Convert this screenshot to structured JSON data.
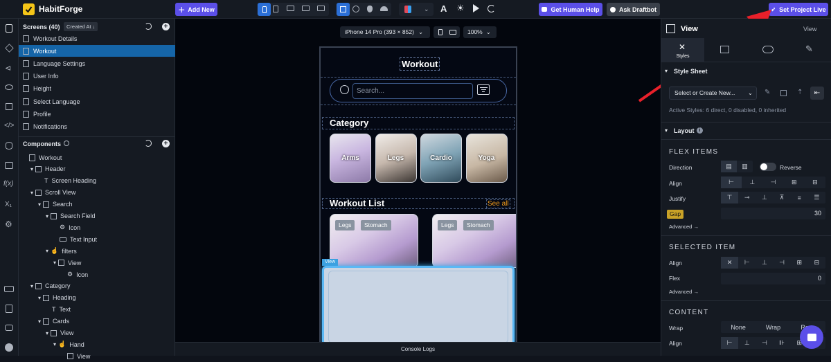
{
  "app": {
    "name": "HabitForge"
  },
  "topbar": {
    "add_new": "Add New",
    "help": "Get Human Help",
    "draftbot": "Ask Draftbot",
    "live": "Set Project Live"
  },
  "screens": {
    "title": "Screens (40)",
    "sort": "Created At ↓",
    "items": [
      "Workout Details",
      "Workout",
      "Language Settings",
      "User Info",
      "Height",
      "Select Language",
      "Profile",
      "Notifications"
    ],
    "selected": "Workout"
  },
  "components": {
    "title": "Components",
    "items": [
      "Workout",
      "Header",
      "Screen Heading",
      "Scroll View",
      "Search",
      "Search Field",
      "Icon",
      "Text Input",
      "filters",
      "View",
      "Icon",
      "Category",
      "Heading",
      "Text",
      "Cards",
      "View",
      "Hand",
      "View"
    ]
  },
  "canvas": {
    "device": "iPhone 14 Pro (393 × 852)",
    "zoom": "100%",
    "console": "Console Logs",
    "phone": {
      "title": "Workout",
      "search_placeholder": "Search...",
      "category_heading": "Category",
      "categories": [
        "Arms",
        "Legs",
        "Cardio",
        "Yoga"
      ],
      "workout_list_heading": "Workout List",
      "see_all": "See all",
      "card_tags": [
        [
          "Legs",
          "Stomach"
        ],
        [
          "Legs",
          "Stomach"
        ]
      ],
      "view_tag": "View"
    }
  },
  "right_panel": {
    "title": "View",
    "title_right": "View",
    "styles_tab": "Styles",
    "stylesheet": "Style Sheet",
    "select_create": "Select or Create New...",
    "active_styles": "Active Styles: 6 direct, 0 disabled, 0 inherited",
    "layout": "Layout",
    "flex_items": "FLEX ITEMS",
    "direction": "Direction",
    "reverse": "Reverse",
    "align": "Align",
    "justify": "Justify",
    "gap": "Gap",
    "gap_value": "30",
    "advanced": "Advanced →",
    "selected_item": "SELECTED ITEM",
    "align2": "Align",
    "flex": "Flex",
    "flex_value": "0",
    "advanced2": "Advanced →",
    "content": "CONTENT",
    "wrap": "Wrap",
    "wrap_options": [
      "None",
      "Wrap",
      "Reve"
    ],
    "align3": "Align"
  },
  "colors": {
    "accent": "#5b4fe8",
    "selected": "#1565a8",
    "brand": "#f5c518",
    "canvas": "#03060d",
    "gap": "#c9a227"
  }
}
